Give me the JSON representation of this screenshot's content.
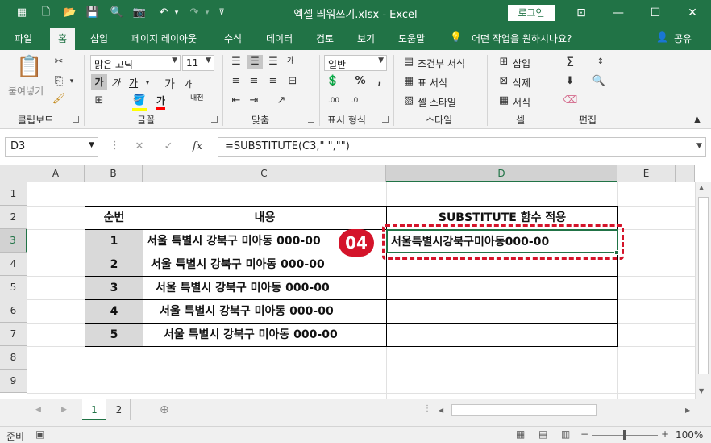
{
  "window": {
    "title": "엑셀 띄워쓰기.xlsx  -  Excel",
    "login_label": "로그인"
  },
  "tabs": [
    "파일",
    "홈",
    "삽입",
    "페이지 레이아웃",
    "수식",
    "데이터",
    "검토",
    "보기",
    "도움말"
  ],
  "tell_me": "어떤 작업을 원하시나요?",
  "share": "공유",
  "ribbon": {
    "clipboard": {
      "label": "클립보드",
      "paste": "붙여넣기"
    },
    "font": {
      "label": "글꼴",
      "font_name": "맑은 고딕",
      "font_size": "11",
      "bold": "가",
      "italic": "가",
      "underline": "가",
      "grow": "가",
      "shrink": "가",
      "font_color": "가",
      "phonetic": "내천"
    },
    "alignment": {
      "label": "맞춤",
      "wrap": "가"
    },
    "number": {
      "label": "표시 형식",
      "format": "일반"
    },
    "styles": {
      "label": "스타일",
      "conditional": "조건부 서식",
      "table": "표 서식",
      "cell": "셀 스타일"
    },
    "cells": {
      "label": "셀",
      "insert": "삽입",
      "delete": "삭제",
      "format": "서식"
    },
    "editing": {
      "label": "편집"
    }
  },
  "formula_bar": {
    "name_box": "D3",
    "fx": "fx",
    "formula": "=SUBSTITUTE(C3,\" \",\"\")"
  },
  "columns": [
    "A",
    "B",
    "C",
    "D",
    "E"
  ],
  "rows": [
    "1",
    "2",
    "3",
    "4",
    "5",
    "6",
    "7",
    "8",
    "9"
  ],
  "table": {
    "header": {
      "num": "순번",
      "content": "내용",
      "result": "SUBSTITUTE 함수 적용"
    },
    "rows": [
      {
        "num": "1",
        "content": "서울 특별시 강북구 미아동 000-00",
        "result": "서울특별시강북구미아동000-00"
      },
      {
        "num": "2",
        "content": "서울 특별시 강북구 미아동 000-00",
        "result": ""
      },
      {
        "num": "3",
        "content": "서울 특별시 강북구 미아동 000-00",
        "result": ""
      },
      {
        "num": "4",
        "content": "서울 특별시 강북구 미아동 000-00",
        "result": ""
      },
      {
        "num": "5",
        "content": "서울 특별시 강북구 미아동 000-00",
        "result": ""
      }
    ]
  },
  "step_badge": "04",
  "sheets": [
    "1",
    "2"
  ],
  "status": {
    "ready": "준비",
    "zoom": "100%"
  }
}
